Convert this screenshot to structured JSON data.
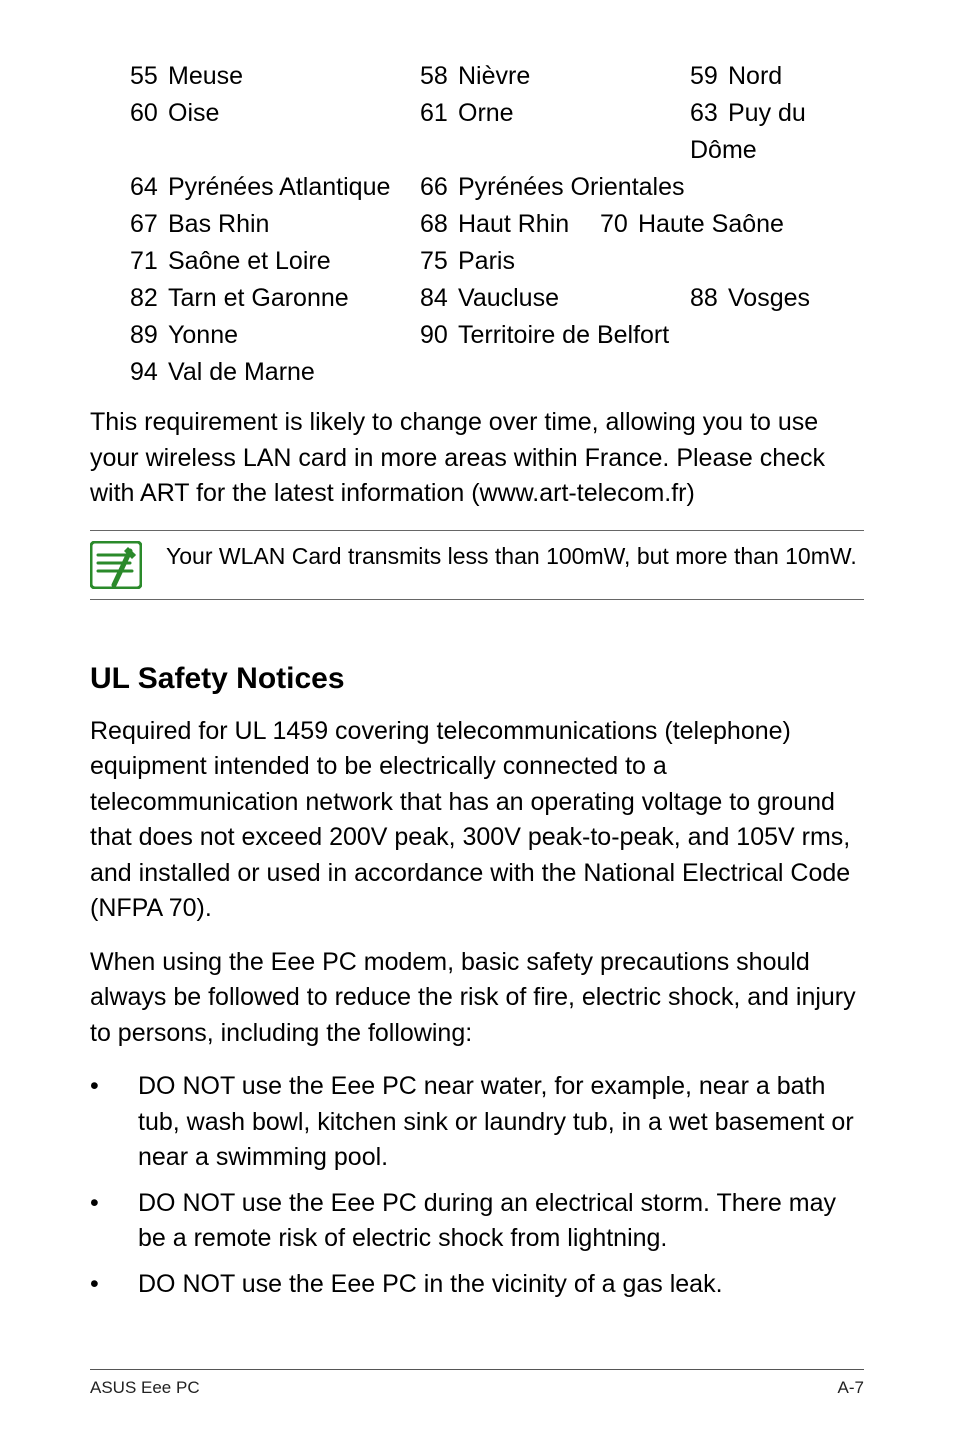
{
  "departments": [
    [
      {
        "num": "55",
        "name": "Meuse"
      },
      {
        "num": "58",
        "name": "Nièvre"
      },
      {
        "num": "59",
        "name": "Nord"
      }
    ],
    [
      {
        "num": "60",
        "name": "Oise"
      },
      {
        "num": "61",
        "name": "Orne"
      },
      {
        "num": "63",
        "name": "Puy du Dôme"
      }
    ],
    [
      {
        "num": "64",
        "name": "Pyrénées Atlantique"
      },
      {
        "num": "66",
        "name": "Pyrénées Orientales"
      },
      null
    ],
    [
      {
        "num": "67",
        "name": "Bas Rhin"
      },
      {
        "num": "68",
        "name": "Haut Rhin"
      },
      {
        "num": "70",
        "name": "Haute Saône"
      }
    ],
    [
      {
        "num": "71",
        "name": "Saône et Loire"
      },
      {
        "num": "75",
        "name": "Paris"
      },
      null
    ],
    [
      {
        "num": "82",
        "name": "Tarn et Garonne"
      },
      {
        "num": "84",
        "name": "Vaucluse"
      },
      {
        "num": "88",
        "name": "Vosges"
      }
    ],
    [
      {
        "num": "89",
        "name": "Yonne"
      },
      {
        "num": "90",
        "name": "Territoire de Belfort"
      },
      null
    ],
    [
      {
        "num": "94",
        "name": "Val de Marne"
      },
      null,
      null
    ]
  ],
  "requirement_paragraph": "This requirement is likely to change over time, allowing you to use your wireless LAN card in more areas within France. Please check with ART for the latest information (www.art-telecom.fr)",
  "note_text": "Your WLAN Card transmits less than 100mW, but more than 10mW.",
  "section_heading": "UL Safety Notices",
  "para1": "Required for UL 1459 covering telecommunications (telephone) equipment intended to be electrically connected to a telecommunication network that has an operating voltage to ground that does not exceed 200V peak, 300V peak-to-peak, and 105V rms, and installed or used in accordance with the National Electrical Code (NFPA 70).",
  "para2": "When using the Eee PC modem, basic safety precautions should always be followed to reduce the risk of fire, electric shock, and injury to persons, including the following:",
  "bullets": [
    "DO NOT use the Eee PC near water, for example, near a bath tub, wash bowl, kitchen sink or laundry tub, in a wet basement or near a swimming pool.",
    "DO NOT use the Eee PC during an electrical storm. There may be a remote risk of electric shock from lightning.",
    "DO NOT use the Eee PC in the vicinity of a gas leak."
  ],
  "footer_left": "ASUS Eee PC",
  "footer_right": "A-7"
}
